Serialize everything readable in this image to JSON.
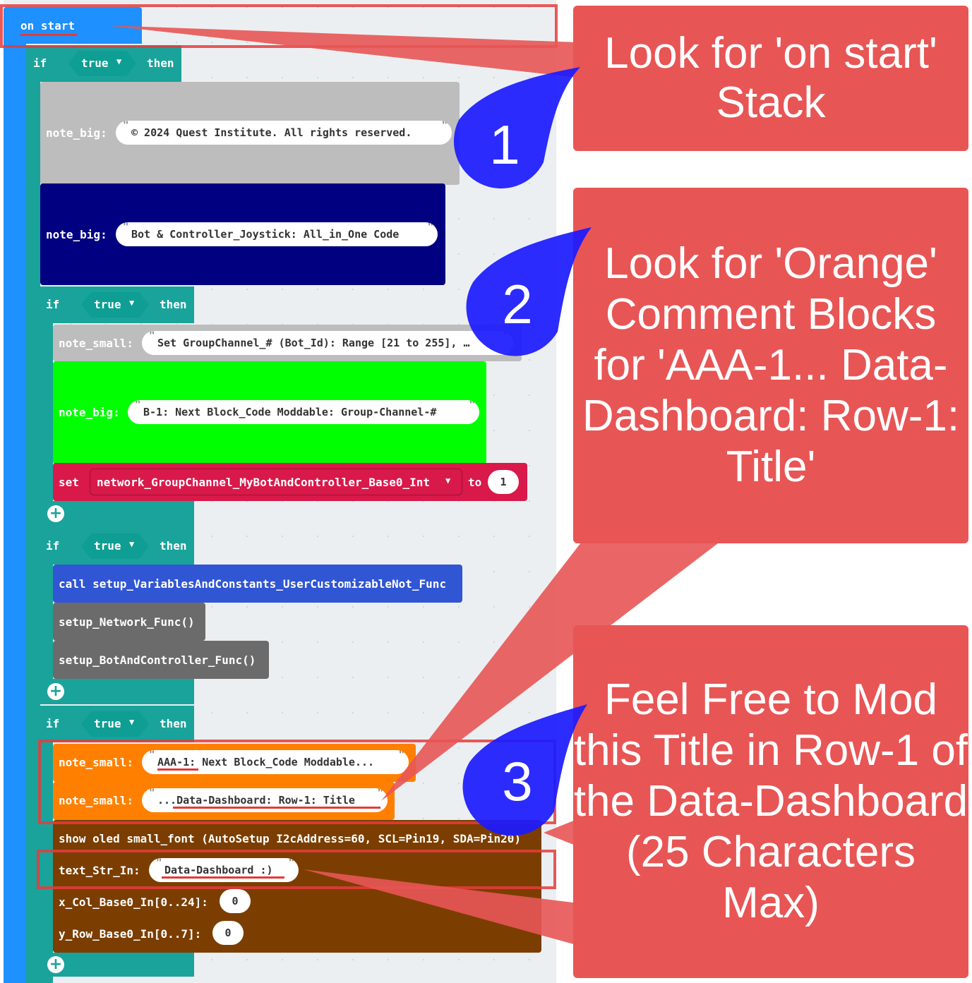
{
  "workspace": {
    "on_start_label": "on start",
    "if_label": "if",
    "then_label": "then",
    "true_label": "true",
    "note_big_label": "note_big:",
    "note_small_label": "note_small:",
    "copyright_text": "© 2024 Quest Institute. All rights reserved.",
    "bot_title_text": "Bot & Controller_Joystick: All_in_One Code",
    "group_channel_note": "Set GroupChannel_# (Bot_Id): Range [21 to 255], …",
    "b1_note": "B-1: Next Block_Code Moddable: Group-Channel-#",
    "set_label": "set",
    "set_variable": "network_GroupChannel_MyBotAndController_Base0_Int",
    "to_label": "to",
    "set_value": "1",
    "call_label": "call setup_VariablesAndConstants_UserCustomizableNot_Func",
    "setup_network": "setup_Network_Func()",
    "setup_bot": "setup_BotAndController_Func()",
    "aaa1_note": "AAA-1: Next Block_Code Moddable...",
    "dashboard_note": "...Data-Dashboard: Row-1: Title",
    "show_oled": "show oled small_font (AutoSetup I2cAddress=60, SCL=Pin19, SDA=Pin20)",
    "text_str_label": "text_Str_In:",
    "text_str_value": "Data-Dashboard :)",
    "x_col_label": "x_Col_Base0_In[0..24]:",
    "x_col_value": "0",
    "y_row_label": "y_Row_Base0_In[0..7]:",
    "y_row_value": "0"
  },
  "callouts": [
    {
      "number": "1",
      "text": "Look for 'on start' Stack"
    },
    {
      "number": "2",
      "text": "Look for 'Orange' Comment Blocks for 'AAA-1... Data-Dashboard: Row-1: Title'"
    },
    {
      "number": "3",
      "text": "Feel Free to Mod this Title in Row-1 of the Data-Dashboard (25 Characters Max)"
    }
  ],
  "colors": {
    "on_start": "#1e90ff",
    "logic": "#1aa39a",
    "note_grey": "#bdbdbd",
    "note_navy": "#000080",
    "note_lime": "#00ff00",
    "set_red": "#d8194a",
    "call_blue": "#3056d3",
    "func_grey": "#6b6b6b",
    "note_orange": "#ff8000",
    "oled_brown": "#7b3e00",
    "callout_red": "#e85555",
    "marker_blue": "#1a1aff"
  }
}
